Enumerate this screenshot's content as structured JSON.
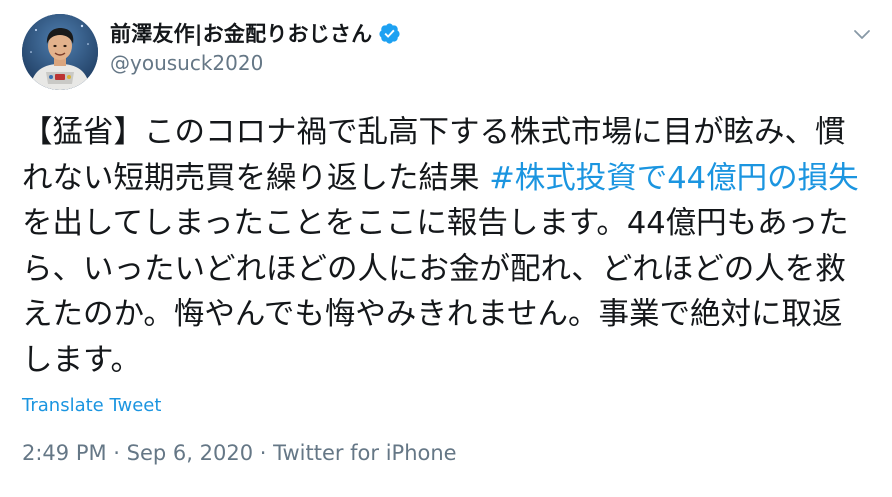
{
  "author": {
    "display_name": "前澤友作|お金配りおじさん",
    "handle": "@yousuck2020",
    "verified": true,
    "avatar_icon": "avatar-astronaut"
  },
  "menu_icon": "chevron-down-icon",
  "tweet": {
    "segments": [
      {
        "text": "【猛省】このコロナ禍で乱高下する株式市場に目が眩み、慣れない短期売買を繰り返した結果 ",
        "type": "text"
      },
      {
        "text": "#株式投資で44億円の損失",
        "type": "hashtag"
      },
      {
        "text": " を出してしまったことをここに報告します。44億円もあったら、いったいどれほどの人にお金が配れ、どれほどの人を救えたのか。悔やんでも悔やみきれません。事業で絶対に取返します。",
        "type": "text"
      }
    ]
  },
  "translate_label": "Translate Tweet",
  "meta": {
    "time": "2:49 PM",
    "separator1": " · ",
    "date": "Sep 6, 2020",
    "separator2": " · ",
    "source": "Twitter for iPhone"
  },
  "colors": {
    "link": "#1b95e0",
    "muted": "#657786",
    "text": "#14171a",
    "verified": "#1da1f2"
  }
}
